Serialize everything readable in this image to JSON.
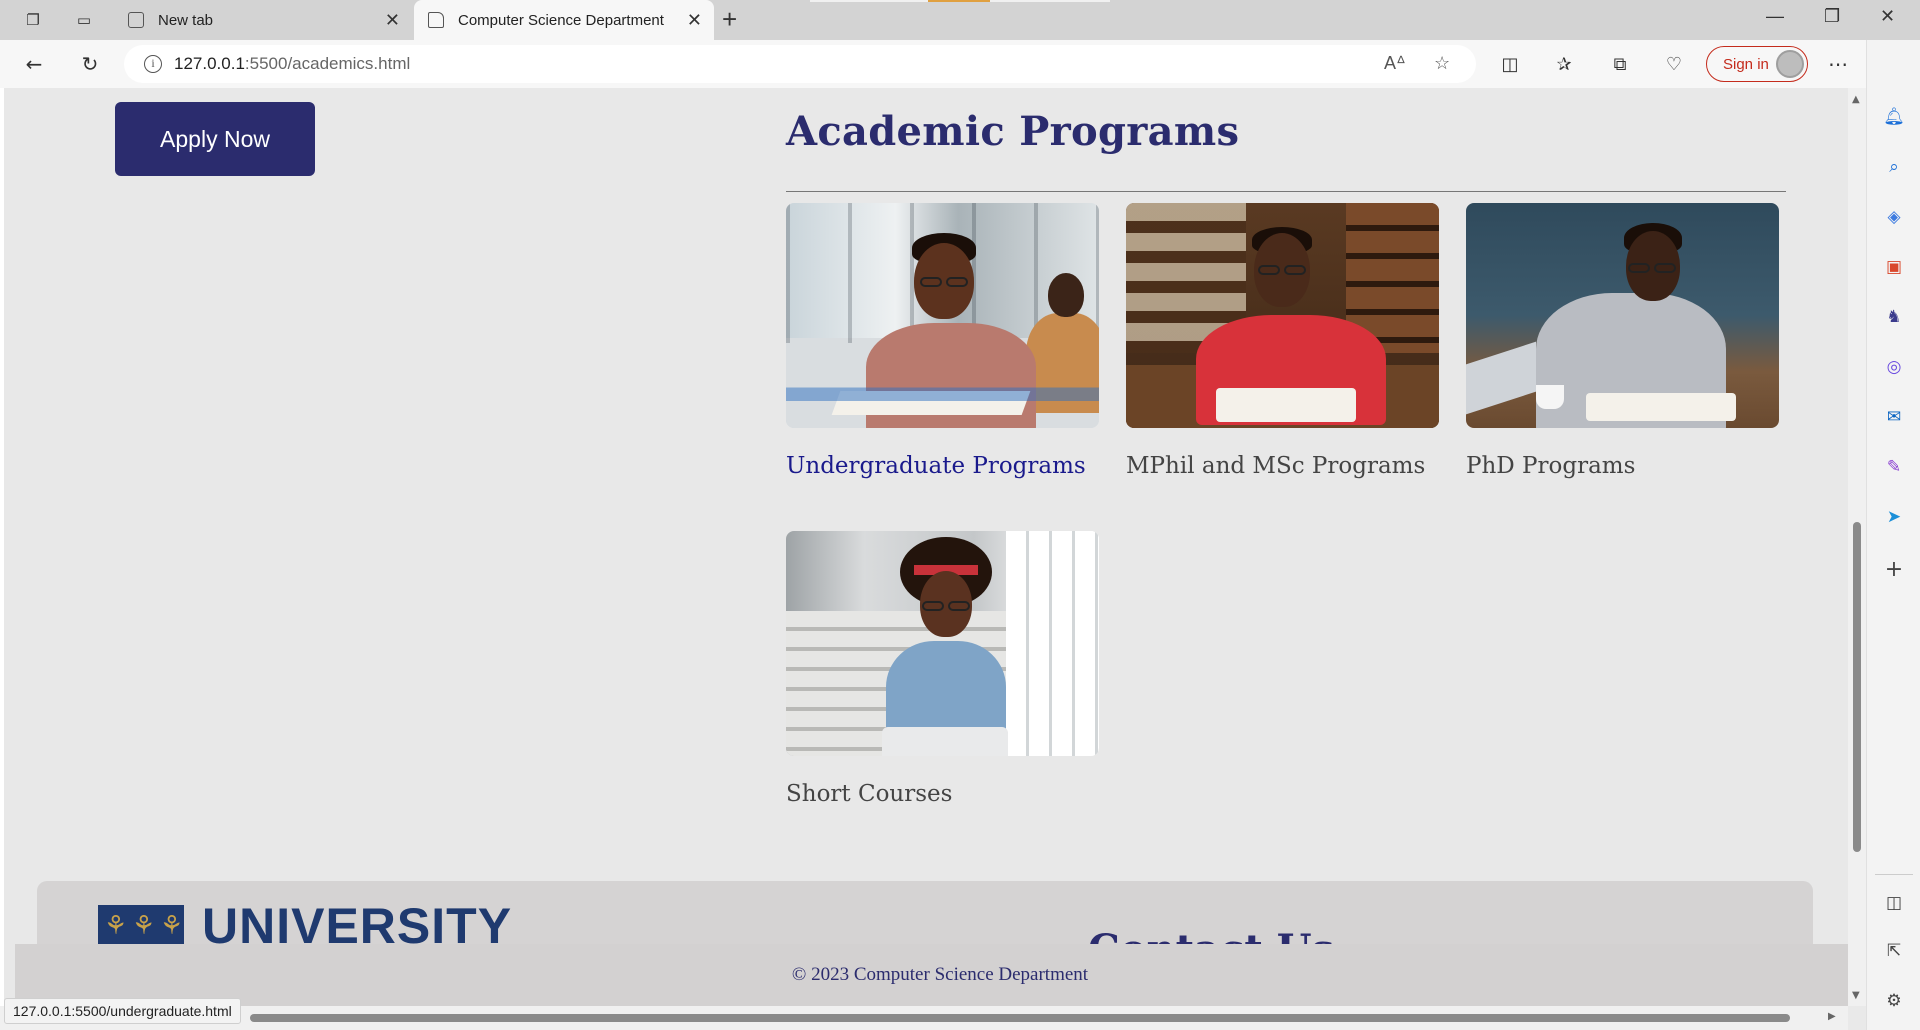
{
  "browser": {
    "tabs": [
      {
        "label": "New tab",
        "active": false
      },
      {
        "label": "Computer Science Department",
        "active": true
      }
    ],
    "address": {
      "host": "127.0.0.1",
      "path": ":5500/academics.html"
    },
    "sign_in_label": "Sign in",
    "status_url": "127.0.0.1:5500/undergraduate.html"
  },
  "page": {
    "apply_button": "Apply Now",
    "section_title": "Academic Programs",
    "programs": [
      {
        "label": "Undergraduate Programs",
        "hovered": true
      },
      {
        "label": "MPhil and MSc Programs",
        "hovered": false
      },
      {
        "label": "PhD Programs",
        "hovered": false
      },
      {
        "label": "Short Courses",
        "hovered": false
      }
    ],
    "footer": {
      "logo_text": "UNIVERSITY",
      "contact_heading": "Contact Us",
      "copyright": "© 2023 Computer Science Department"
    }
  },
  "colors": {
    "brand_navy": "#2b2c6e",
    "link_blue": "#1a1a8c",
    "page_bg": "#e8e8e8",
    "footer_bg": "#d5d3d3",
    "logo_gold": "#c8a24a"
  },
  "icons": {
    "sidebar": [
      "bell-icon",
      "search-icon",
      "tag-icon",
      "toolbox-icon",
      "chess-icon",
      "copilot-circle-icon",
      "outlook-icon",
      "designer-icon",
      "send-icon",
      "add-icon",
      "split-view-icon",
      "external-link-icon",
      "settings-icon"
    ]
  }
}
